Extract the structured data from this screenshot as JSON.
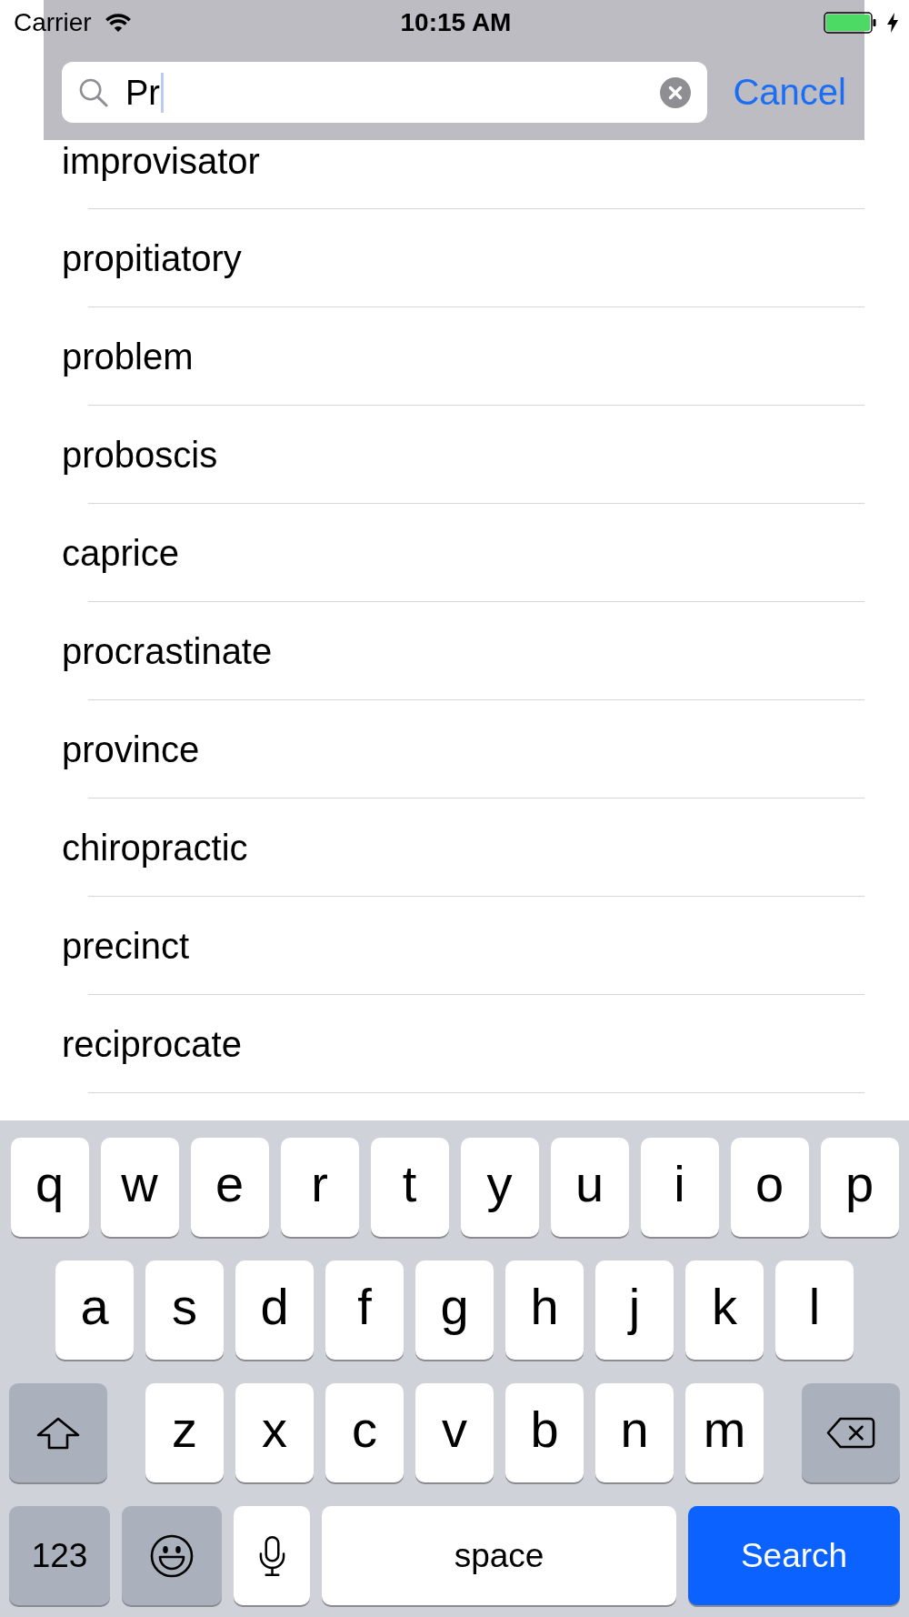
{
  "status_bar": {
    "carrier": "Carrier",
    "time": "10:15 AM"
  },
  "search_bar": {
    "value": "Pr",
    "focused": true,
    "cancel": "Cancel"
  },
  "results": [
    "improvisator",
    "propitiatory",
    "problem",
    "proboscis",
    "caprice",
    "procrastinate",
    "province",
    "chiropractic",
    "precinct",
    "reciprocate"
  ],
  "keyboard": {
    "rows": [
      {
        "keys": [
          {
            "kind": "letter",
            "label": "q"
          },
          {
            "kind": "letter",
            "label": "w"
          },
          {
            "kind": "letter",
            "label": "e"
          },
          {
            "kind": "letter",
            "label": "r"
          },
          {
            "kind": "letter",
            "label": "t"
          },
          {
            "kind": "letter",
            "label": "y"
          },
          {
            "kind": "letter",
            "label": "u"
          },
          {
            "kind": "letter",
            "label": "i"
          },
          {
            "kind": "letter",
            "label": "o"
          },
          {
            "kind": "letter",
            "label": "p"
          }
        ]
      },
      {
        "keys": [
          {
            "kind": "letter",
            "label": "a"
          },
          {
            "kind": "letter",
            "label": "s"
          },
          {
            "kind": "letter",
            "label": "d"
          },
          {
            "kind": "letter",
            "label": "f"
          },
          {
            "kind": "letter",
            "label": "g"
          },
          {
            "kind": "letter",
            "label": "h"
          },
          {
            "kind": "letter",
            "label": "j"
          },
          {
            "kind": "letter",
            "label": "k"
          },
          {
            "kind": "letter",
            "label": "l"
          }
        ]
      },
      {
        "keys": [
          {
            "kind": "shift",
            "on": false
          },
          {
            "kind": "letter",
            "label": "z"
          },
          {
            "kind": "letter",
            "label": "x"
          },
          {
            "kind": "letter",
            "label": "c"
          },
          {
            "kind": "letter",
            "label": "v"
          },
          {
            "kind": "letter",
            "label": "b"
          },
          {
            "kind": "letter",
            "label": "n"
          },
          {
            "kind": "letter",
            "label": "m"
          },
          {
            "kind": "delete"
          }
        ]
      },
      {
        "keys": [
          {
            "kind": "mode",
            "label": "123"
          },
          {
            "kind": "emoji"
          },
          {
            "kind": "dictation"
          },
          {
            "kind": "space",
            "label": "space"
          },
          {
            "kind": "return",
            "label": "Search",
            "disabled": false
          }
        ]
      }
    ]
  }
}
